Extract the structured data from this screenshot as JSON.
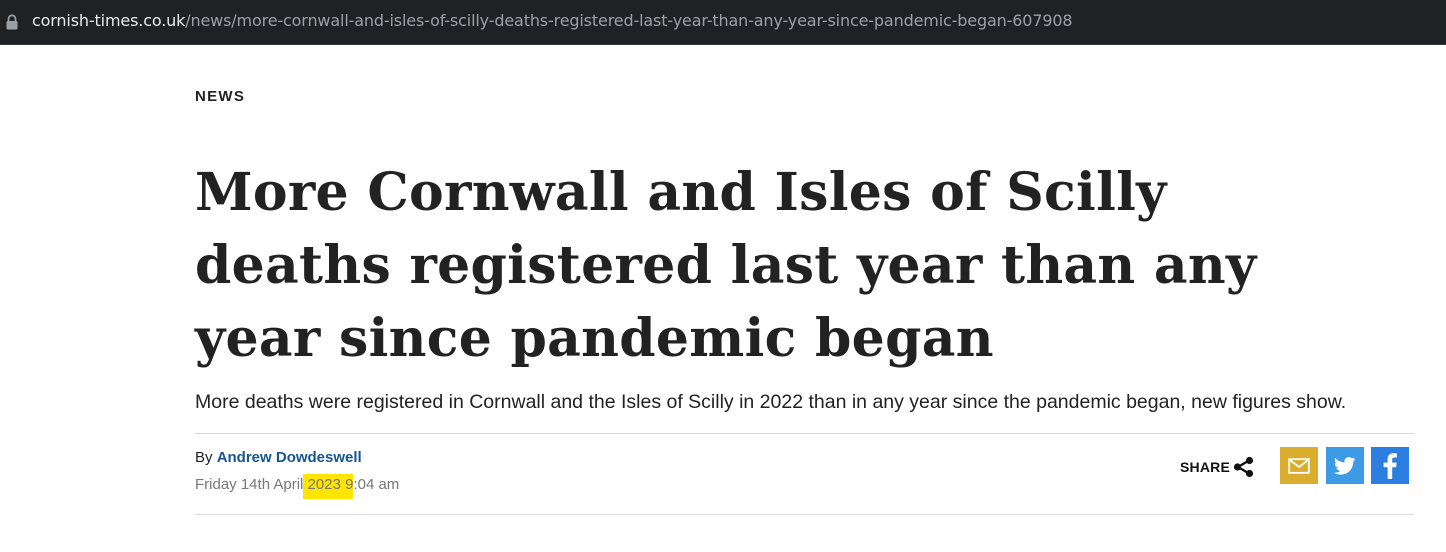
{
  "browser": {
    "url_domain": "cornish-times.co.uk",
    "url_path": "/news/more-cornwall-and-isles-of-scilly-deaths-registered-last-year-than-any-year-since-pandemic-began-607908"
  },
  "article": {
    "section": "NEWS",
    "headline": "More Cornwall and Isles of Scilly deaths registered last year than any year since pandemic began",
    "standfirst": "More deaths were registered in Cornwall and the Isles of Scilly in 2022 than in any year since the pandemic began, new figures show.",
    "byline_prefix": "By ",
    "author": "Andrew Dowdeswell",
    "date_before_highlight": "Friday 14th April",
    "date_highlighted": " 2023 9",
    "date_after_highlight": ":04 am"
  },
  "share": {
    "label": "SHARE",
    "buttons": [
      {
        "name": "email",
        "icon": "envelope-icon",
        "color": "#d9ae2f"
      },
      {
        "name": "twitter",
        "icon": "twitter-bird-icon",
        "color": "#3d9be5"
      },
      {
        "name": "facebook",
        "icon": "facebook-f-icon",
        "color": "#2c7ee0"
      }
    ]
  },
  "colors": {
    "highlight": "#ffe500",
    "author_link": "#17558f",
    "url_bar": "#202124"
  }
}
